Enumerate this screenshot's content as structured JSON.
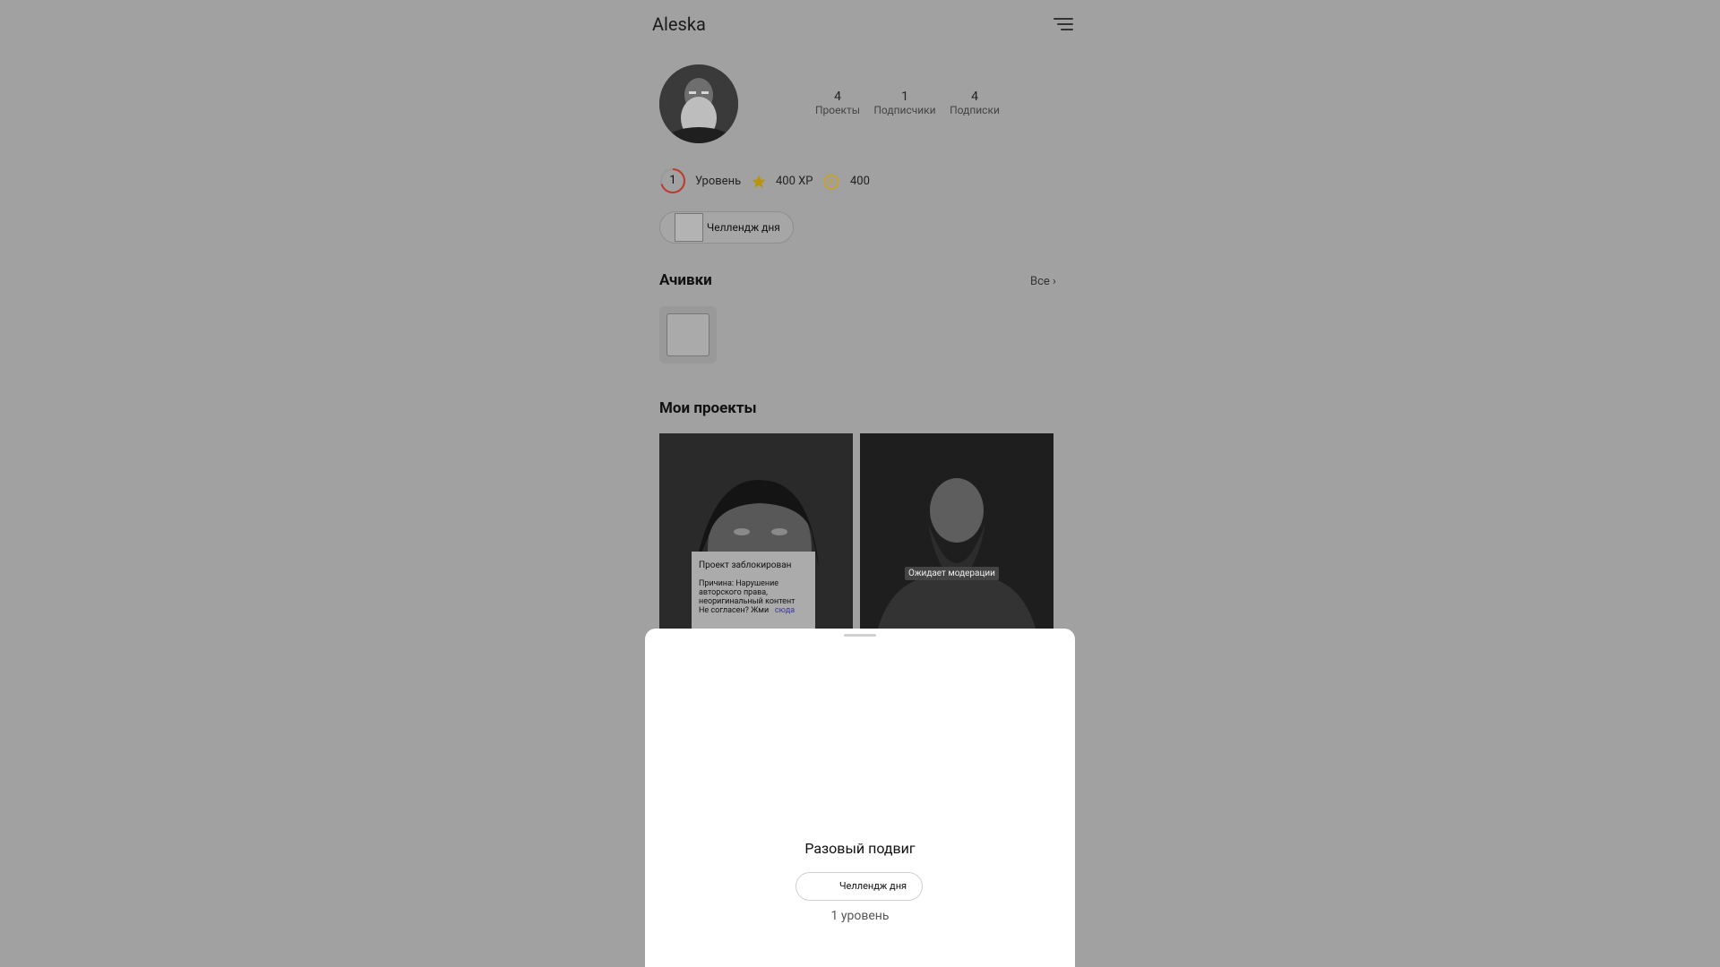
{
  "header": {
    "title": "Aleska"
  },
  "stats": [
    {
      "value": "4",
      "label": "Проекты"
    },
    {
      "value": "1",
      "label": "Подписчики"
    },
    {
      "value": "4",
      "label": "Подписки"
    }
  ],
  "level": {
    "number": "1",
    "label": "Уровень",
    "xp": "400 XP",
    "coins": "400"
  },
  "challenge_chip": {
    "label": "Челлендж дня"
  },
  "achievements": {
    "title": "Ачивки",
    "all_label": "Все ›"
  },
  "projects": {
    "title": "Мои проекты",
    "blocked": {
      "title": "Проект заблокирован",
      "reason": "Причина: Нарушение авторского права, неоригинальный контент",
      "disagree": "Не согласен? Жми",
      "link": "сюда"
    },
    "moderation_label": "Ожидает модерации"
  },
  "sheet": {
    "title": "Разовый подвиг",
    "chip_label": "Челлендж дня",
    "level_label": "1 уровень"
  },
  "colors": {
    "backdrop": "#a1a1a1",
    "level_ring": "#c0392b",
    "star": "#b8960c",
    "coin": "#c9a227",
    "link": "#3b2fb0"
  }
}
